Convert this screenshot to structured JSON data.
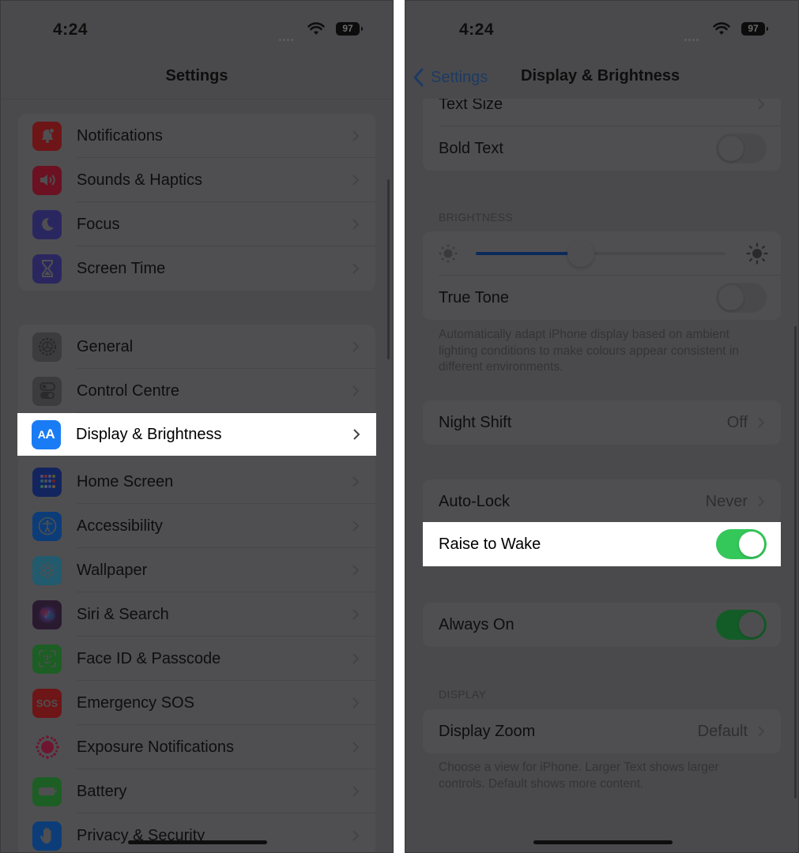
{
  "left": {
    "status": {
      "time": "4:24",
      "battery": "97"
    },
    "nav": {
      "title": "Settings"
    },
    "groups": [
      [
        {
          "label": "Notifications",
          "icon": "bell-icon",
          "color": "#6e1517"
        },
        {
          "label": "Sounds & Haptics",
          "icon": "speaker-icon",
          "color": "#6b1121"
        },
        {
          "label": "Focus",
          "icon": "moon-icon",
          "color": "#2a2760"
        },
        {
          "label": "Screen Time",
          "icon": "hourglass-icon",
          "color": "#2a2760"
        }
      ],
      [
        {
          "label": "General",
          "icon": "gear-icon",
          "color": "#3c3c3e"
        },
        {
          "label": "Control Centre",
          "icon": "switches-icon",
          "color": "#3c3c3e"
        },
        {
          "label": "Display & Brightness",
          "icon": "text-size-icon",
          "color": "#1a7cf5",
          "highlighted": true
        },
        {
          "label": "Home Screen",
          "icon": "app-grid-icon",
          "color": "#13255f"
        },
        {
          "label": "Accessibility",
          "icon": "accessibility-icon",
          "color": "#0c3d78"
        },
        {
          "label": "Wallpaper",
          "icon": "flower-icon",
          "color": "#225a6e"
        },
        {
          "label": "Siri & Search",
          "icon": "siri-icon",
          "color": "#2a1a30"
        },
        {
          "label": "Face ID & Passcode",
          "icon": "face-id-icon",
          "color": "#1d5e24"
        },
        {
          "label": "Emergency SOS",
          "icon": "sos-icon",
          "color": "#6e1517"
        },
        {
          "label": "Exposure Notifications",
          "icon": "exposure-icon",
          "color": "#4f4f51"
        },
        {
          "label": "Battery",
          "icon": "battery-icon",
          "color": "#1d5e24"
        },
        {
          "label": "Privacy & Security",
          "icon": "hand-icon",
          "color": "#0c3d78"
        }
      ]
    ]
  },
  "right": {
    "status": {
      "time": "4:24",
      "battery": "97"
    },
    "nav": {
      "back_label": "Settings",
      "title": "Display & Brightness"
    },
    "text_group": {
      "text_size": "Text Size",
      "bold_text": "Bold Text",
      "bold_text_on": false
    },
    "brightness": {
      "header": "BRIGHTNESS",
      "level_percent": 42,
      "true_tone": "True Tone",
      "true_tone_on": false,
      "footnote": "Automatically adapt iPhone display based on ambient lighting conditions to make colours appear consistent in different environments."
    },
    "night_shift": {
      "label": "Night Shift",
      "value": "Off"
    },
    "lock_group": {
      "auto_lock": "Auto-Lock",
      "auto_lock_value": "Never",
      "raise_to_wake": "Raise to Wake",
      "raise_to_wake_on": true
    },
    "always_on": {
      "label": "Always On",
      "on": true
    },
    "display": {
      "header": "DISPLAY",
      "zoom_label": "Display Zoom",
      "zoom_value": "Default",
      "footnote": "Choose a view for iPhone. Larger Text shows larger controls. Default shows more content."
    }
  }
}
